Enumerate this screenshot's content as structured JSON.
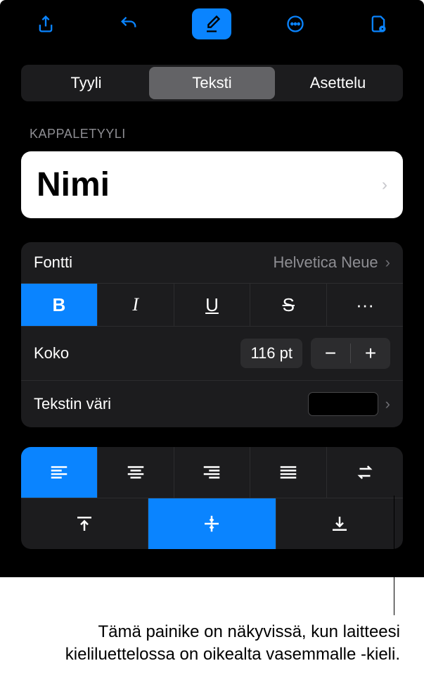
{
  "toolbar": {
    "share": "share-icon",
    "undo": "undo-icon",
    "format": "format-brush-icon",
    "more": "more-icon",
    "doc": "document-options-icon"
  },
  "tabs": {
    "style": "Tyyli",
    "text": "Teksti",
    "layout": "Asettelu"
  },
  "paragraph_style": {
    "label": "KAPPALETYYLI",
    "current": "Nimi"
  },
  "font": {
    "label": "Fontti",
    "value": "Helvetica Neue",
    "bold": "B",
    "italic": "I",
    "underline": "U",
    "strike": "S",
    "more": "···"
  },
  "size": {
    "label": "Koko",
    "value": "116 pt",
    "minus": "−",
    "plus": "+"
  },
  "text_color": {
    "label": "Tekstin väri",
    "value": "#000000"
  },
  "callout": "Tämä painike on näkyvissä, kun laitteesi kieliluettelossa on oikealta vasemmalle -kieli."
}
